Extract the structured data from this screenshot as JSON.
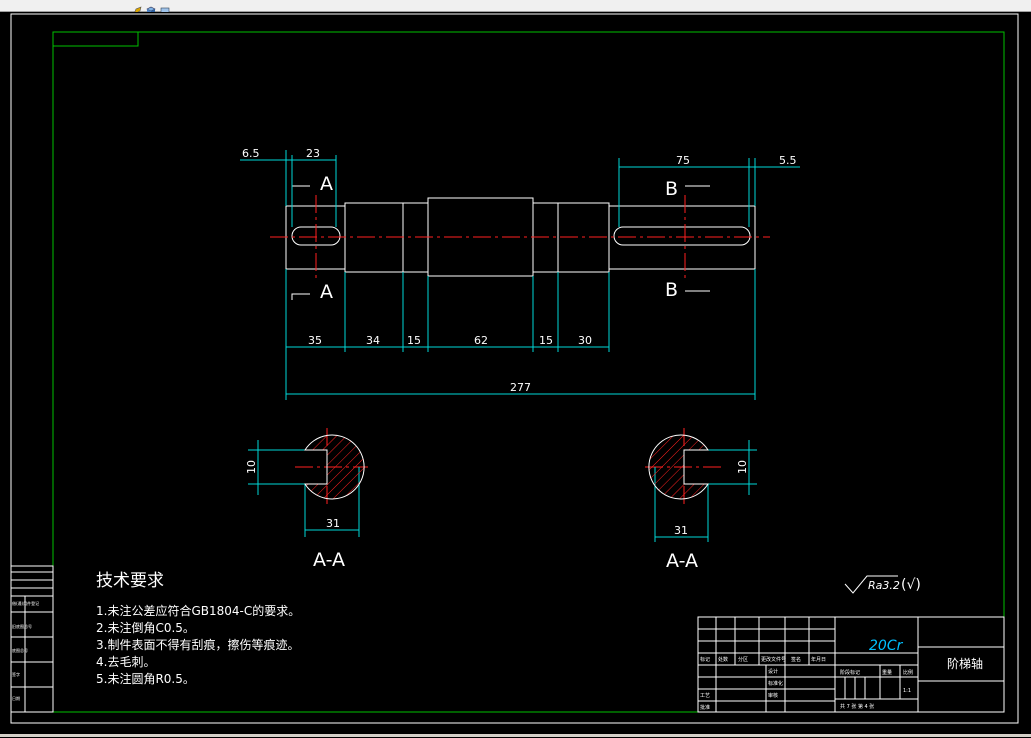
{
  "drawing": {
    "dimensions": {
      "d_6_5": "6.5",
      "d_23": "23",
      "d_75": "75",
      "d_5_5": "5.5",
      "d_35": "35",
      "d_34": "34",
      "d_15a": "15",
      "d_62": "62",
      "d_15b": "15",
      "d_30": "30",
      "d_277": "277",
      "d_10_left": "10",
      "d_31_left": "31",
      "d_31_right": "31",
      "d_10_right": "10"
    },
    "section_marks": {
      "a_top": "A",
      "a_bottom": "A",
      "b_top": "B",
      "b_bottom": "B"
    },
    "section_labels": {
      "left": "A-A",
      "right": "A-A"
    },
    "tech": {
      "title": "技术要求",
      "items": [
        "1.未注公差应符合GB1804-C的要求。",
        "2.未注倒角C0.5。",
        "3.制件表面不得有刮痕，擦伤等痕迹。",
        "4.去毛刺。",
        "5.未注圆角R0.5。"
      ]
    },
    "roughness": {
      "value": "Ra3.2",
      "suffix": "(√)"
    },
    "title_block": {
      "material": "20Cr",
      "part_name": "阶梯轴",
      "row_labels": [
        "标记",
        "处数",
        "分区",
        "更改文件号",
        "签名",
        "年月日"
      ],
      "left_labels": [
        "设计",
        "标准化",
        "审核",
        "工艺",
        "批准"
      ],
      "mid_labels": [
        "阶段标记",
        "重量",
        "比例"
      ],
      "scale": "1:1",
      "sheets": "共 7 张 第 4 张"
    },
    "side_table": {
      "labels": [
        "借(通)用件登记",
        "旧底图总号",
        "底图总号",
        "签字",
        "日期"
      ]
    }
  }
}
